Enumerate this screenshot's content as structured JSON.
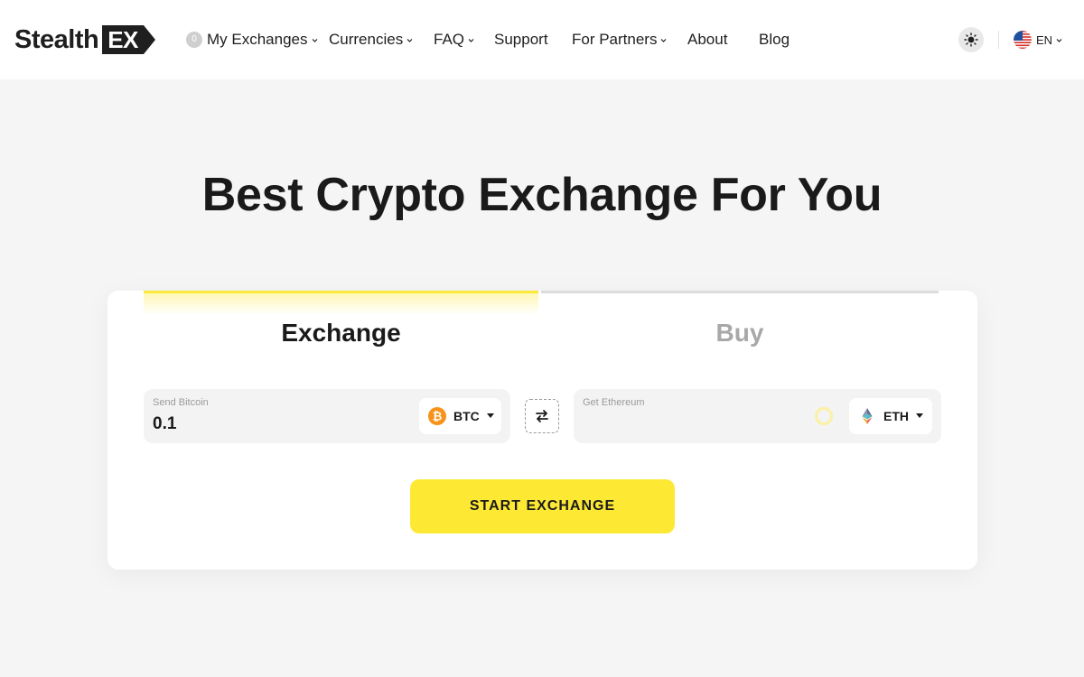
{
  "brand": {
    "name_word": "Stealth",
    "name_badge": "EX"
  },
  "nav": {
    "my_exchanges": {
      "label": "My Exchanges",
      "count": "0"
    },
    "items": [
      {
        "label": "Currencies",
        "has_dropdown": true
      },
      {
        "label": "FAQ",
        "has_dropdown": true
      },
      {
        "label": "Support",
        "has_dropdown": false
      },
      {
        "label": "For Partners",
        "has_dropdown": true
      },
      {
        "label": "About",
        "has_dropdown": false
      },
      {
        "label": "Blog",
        "has_dropdown": false
      }
    ]
  },
  "header_right": {
    "theme_icon": "sun-icon",
    "language": "EN",
    "flag_icon": "us-flag-icon"
  },
  "hero": {
    "title": "Best Crypto Exchange For You"
  },
  "widget": {
    "tabs": [
      {
        "label": "Exchange",
        "active": true
      },
      {
        "label": "Buy",
        "active": false
      }
    ],
    "send": {
      "label": "Send Bitcoin",
      "value": "0.1",
      "ticker": "BTC",
      "icon": "bitcoin-icon"
    },
    "get": {
      "label": "Get Ethereum",
      "value": "",
      "ticker": "ETH",
      "icon": "ethereum-icon",
      "loading": true
    },
    "swap_icon": "swap-arrows-icon",
    "submit_label": "START EXCHANGE"
  },
  "colors": {
    "accent": "#fde934",
    "tab_active_bar": "#fce93a",
    "tab_inactive_bar": "#dcdcdc",
    "background": "#f5f5f5",
    "bitcoin": "#f7931a"
  }
}
